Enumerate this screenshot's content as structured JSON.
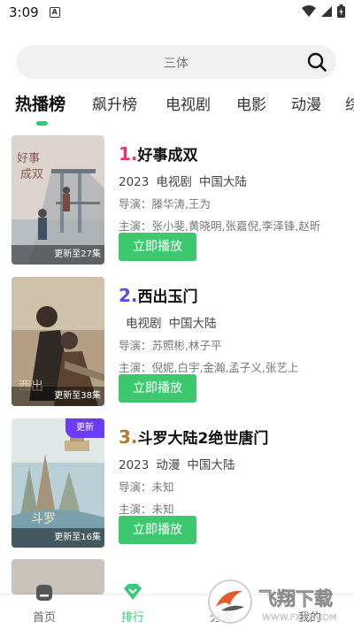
{
  "status_bar": {
    "time": "3:09",
    "indicator": "A"
  },
  "search": {
    "text": "三体"
  },
  "tabs": [
    {
      "label": "热播榜",
      "active": true
    },
    {
      "label": "飙升榜",
      "active": false
    },
    {
      "label": "电视剧",
      "active": false
    },
    {
      "label": "电影",
      "active": false
    },
    {
      "label": "动漫",
      "active": false
    },
    {
      "label": "综",
      "active": false
    }
  ],
  "items": [
    {
      "rank": "1.",
      "rank_color": "#e0367a",
      "title": "好事成双",
      "year": "2023",
      "genre": "电视剧",
      "region": "中国大陆",
      "director": "导演：滕华涛,王为",
      "cast": "主演：张小斐,黄晓明,张嘉倪,李泽锋,赵昕",
      "episodes": "更新至27集",
      "play_label": "立即播放"
    },
    {
      "rank": "2.",
      "rank_color": "#5a4fd6",
      "title": "西出玉门",
      "year": "",
      "genre": "电视剧",
      "region": "中国大陆",
      "director": "导演：苏照彬,林子平",
      "cast": "主演：倪妮,白宇,金瀚,孟子义,张艺上",
      "episodes": "更新至38集",
      "play_label": "立即播放"
    },
    {
      "rank": "3.",
      "rank_color": "#b37a2c",
      "title": "斗罗大陆2绝世唐门",
      "year": "2023",
      "genre": "动漫",
      "region": "中国大陆",
      "director": "导演：未知",
      "cast": "主演：未知",
      "episodes": "更新至16集",
      "badge": "更新",
      "play_label": "立即播放"
    }
  ],
  "bottom_nav": [
    {
      "label": "首页",
      "icon": "home-icon",
      "active": false
    },
    {
      "label": "排行",
      "icon": "ranking-diamond-icon",
      "active": true
    },
    {
      "label": "分类",
      "icon": "category-icon",
      "active": false
    },
    {
      "label": "我的",
      "icon": "profile-icon",
      "active": false
    }
  ],
  "watermark": {
    "text": "飞翔下载",
    "url": "WWW.FXXZ.COM"
  },
  "colors": {
    "accent": "#36c97a",
    "play_button": "#3ec86d",
    "new_badge": "#6c3cf5"
  }
}
